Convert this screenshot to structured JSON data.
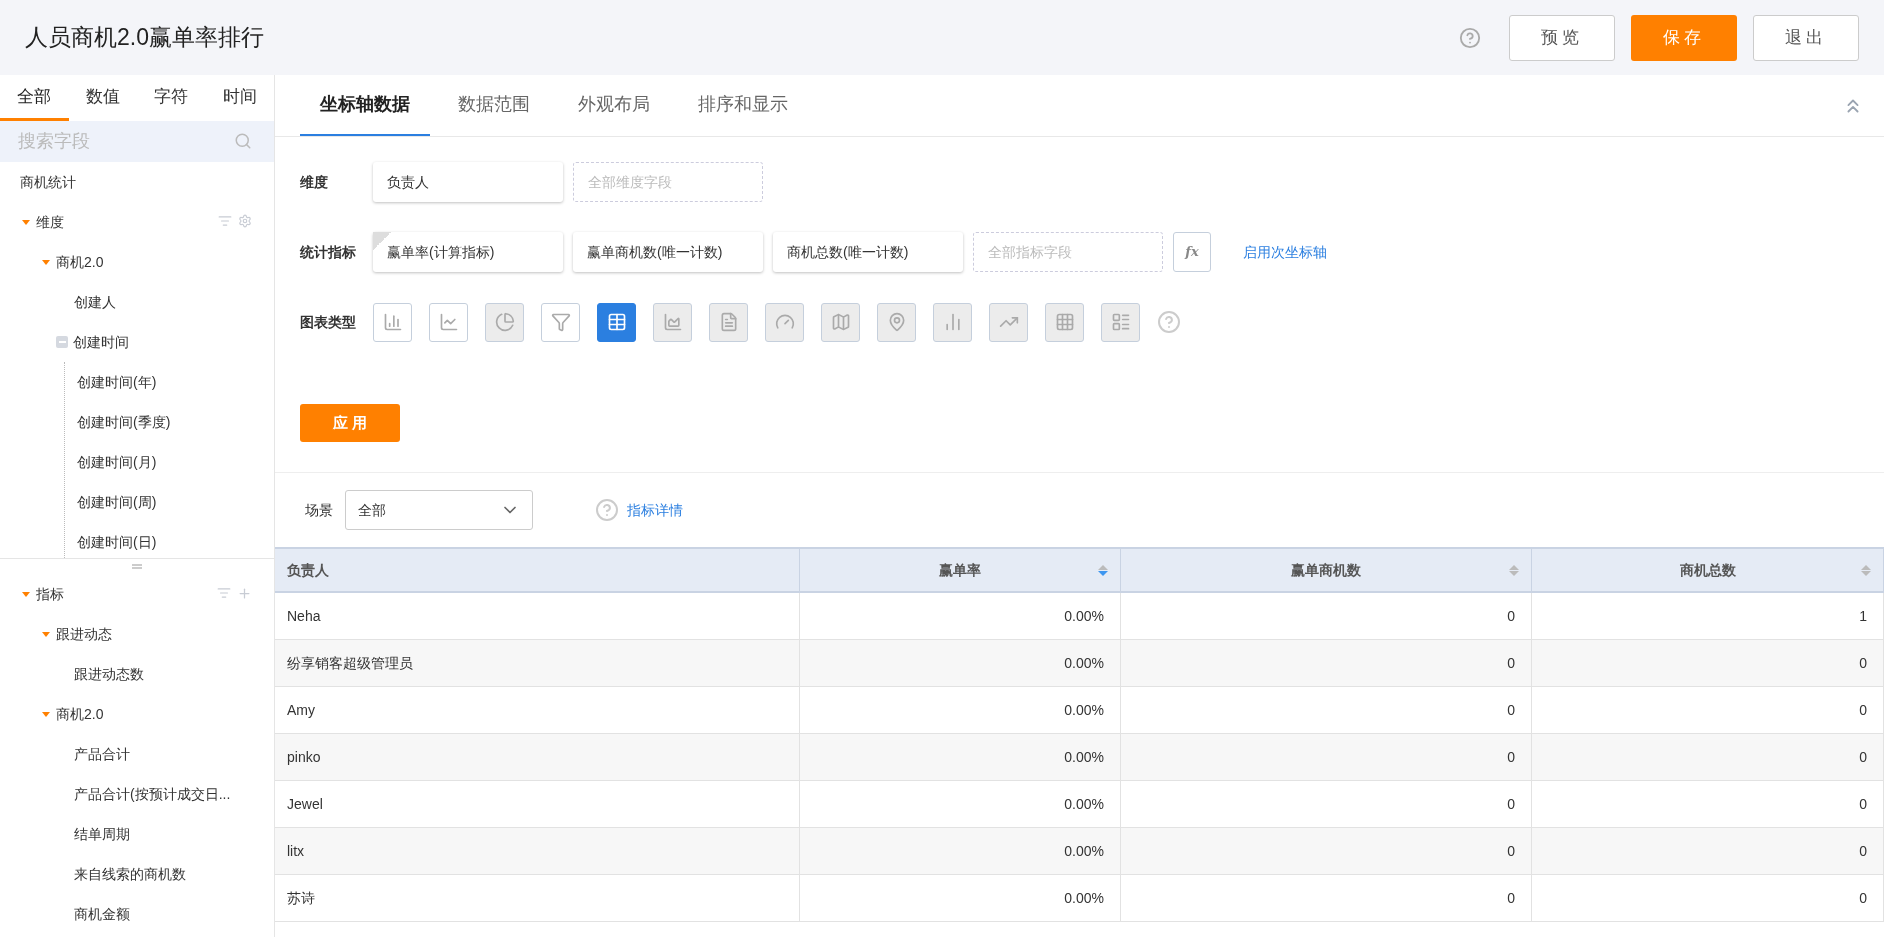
{
  "header": {
    "title": "人员商机2.0赢单率排行",
    "buttons": [
      {
        "label": "预览",
        "kind": "default"
      },
      {
        "label": "保存",
        "kind": "primary"
      },
      {
        "label": "退出",
        "kind": "default"
      }
    ]
  },
  "sidebar": {
    "tabs": [
      {
        "label": "全部",
        "selected": true
      },
      {
        "label": "数值",
        "selected": false
      },
      {
        "label": "字符",
        "selected": false
      },
      {
        "label": "时间",
        "selected": false
      }
    ],
    "search": {
      "placeholder": "搜索字段"
    },
    "source": "商机统计",
    "dimension_tree": {
      "label": "维度",
      "expanded": true,
      "children": [
        {
          "label": "商机2.0",
          "expanded": true,
          "children": [
            {
              "label": "创建人"
            },
            {
              "label": "创建时间",
              "expanded": true,
              "children": [
                {
                  "label": "创建时间(年)"
                },
                {
                  "label": "创建时间(季度)"
                },
                {
                  "label": "创建时间(月)"
                },
                {
                  "label": "创建时间(周)"
                },
                {
                  "label": "创建时间(日)"
                }
              ]
            }
          ]
        }
      ]
    },
    "metric_tree": {
      "label": "指标",
      "expanded": true,
      "children": [
        {
          "label": "跟进动态",
          "expanded": true,
          "children": [
            {
              "label": "跟进动态数"
            }
          ]
        },
        {
          "label": "商机2.0",
          "expanded": true,
          "children": [
            {
              "label": "产品合计"
            },
            {
              "label": "产品合计(按预计成交日..."
            },
            {
              "label": "结单周期"
            },
            {
              "label": "来自线索的商机数"
            },
            {
              "label": "商机金额"
            }
          ]
        }
      ]
    }
  },
  "config": {
    "tabs": [
      {
        "label": "坐标轴数据",
        "selected": true
      },
      {
        "label": "数据范围",
        "selected": false
      },
      {
        "label": "外观布局",
        "selected": false
      },
      {
        "label": "排序和显示",
        "selected": false
      }
    ],
    "dimension": {
      "label": "维度",
      "fields": [
        {
          "label": "负责人"
        }
      ],
      "placeholder": "全部维度字段"
    },
    "metrics": {
      "label": "统计指标",
      "fields": [
        {
          "label": "赢单率(计算指标)",
          "calculated": true
        },
        {
          "label": "赢单商机数(唯一计数)",
          "calculated": false
        },
        {
          "label": "商机总数(唯一计数)",
          "calculated": false
        }
      ],
      "placeholder": "全部指标字段",
      "fx_label": "fx",
      "link": "启用次坐标轴"
    },
    "chart_types": {
      "label": "图表类型",
      "items": [
        {
          "kind": "bar",
          "selected": false,
          "disabled": false
        },
        {
          "kind": "line",
          "selected": false,
          "disabled": false
        },
        {
          "kind": "pie",
          "selected": false,
          "disabled": true
        },
        {
          "kind": "funnel",
          "selected": false,
          "disabled": false
        },
        {
          "kind": "table",
          "selected": true
        },
        {
          "kind": "area",
          "selected": false,
          "disabled": true
        },
        {
          "kind": "text",
          "selected": false,
          "disabled": true
        },
        {
          "kind": "gauge",
          "selected": false,
          "disabled": true
        },
        {
          "kind": "map",
          "selected": false,
          "disabled": true
        },
        {
          "kind": "scattermap",
          "selected": false,
          "disabled": true
        },
        {
          "kind": "column",
          "selected": false,
          "disabled": true
        },
        {
          "kind": "multiline",
          "selected": false,
          "disabled": true
        },
        {
          "kind": "heatmap",
          "selected": false,
          "disabled": true
        },
        {
          "kind": "pivot",
          "selected": false,
          "disabled": true
        }
      ]
    },
    "apply": "应 用"
  },
  "scene": {
    "label": "场景",
    "value": "全部",
    "link": "指标详情"
  },
  "table": {
    "columns": [
      {
        "label": "负责人"
      },
      {
        "label": "赢单率",
        "sorted": true
      },
      {
        "label": "赢单商机数",
        "sorted": false
      },
      {
        "label": "商机总数",
        "sorted": false
      }
    ],
    "rows": [
      [
        "Neha",
        "0.00%",
        "0",
        "1"
      ],
      [
        "纷享销客超级管理员",
        "0.00%",
        "0",
        "0"
      ],
      [
        "Amy",
        "0.00%",
        "0",
        "0"
      ],
      [
        "pinko",
        "0.00%",
        "0",
        "0"
      ],
      [
        "Jewel",
        "0.00%",
        "0",
        "0"
      ],
      [
        "litx",
        "0.00%",
        "0",
        "0"
      ],
      [
        "苏诗",
        "0.00%",
        "0",
        "0"
      ]
    ]
  }
}
